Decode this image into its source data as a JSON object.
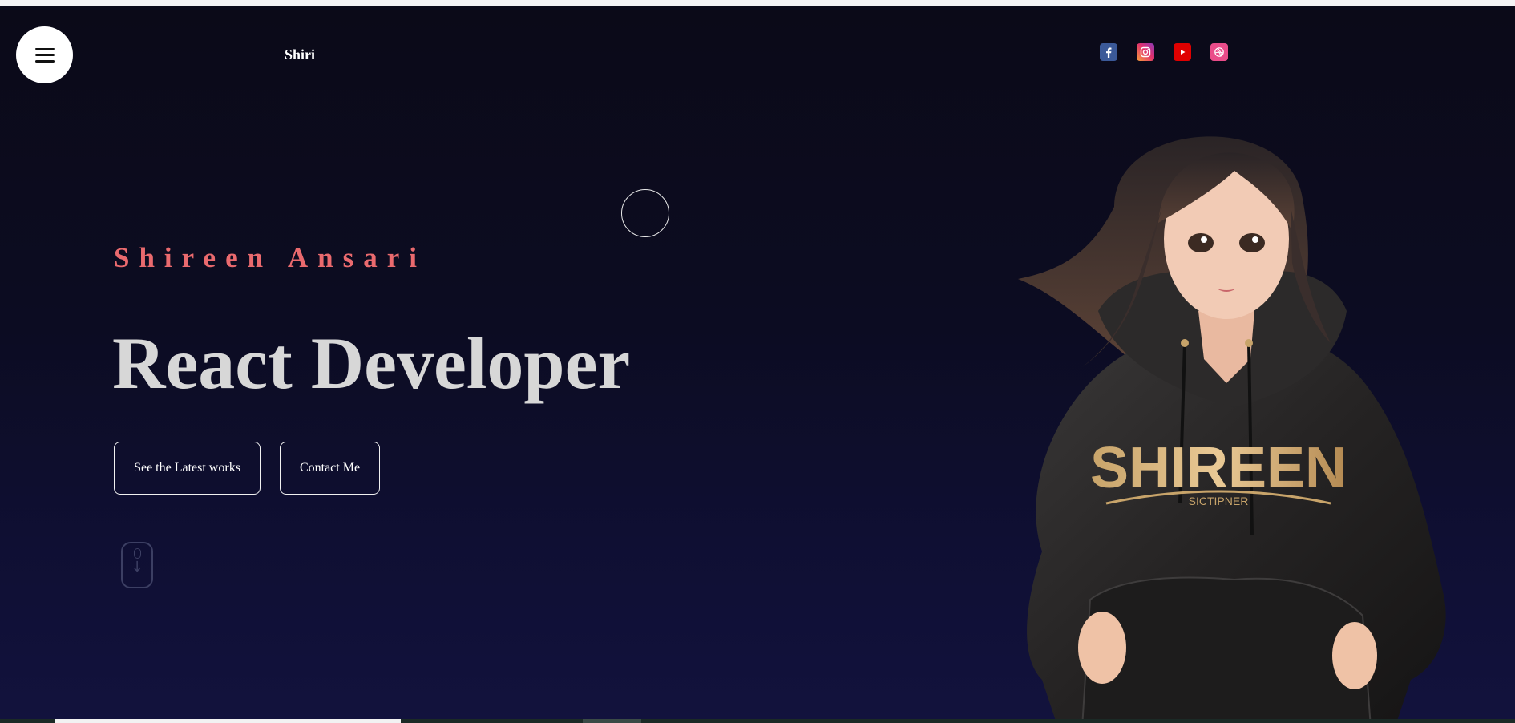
{
  "header": {
    "logo_text": "Shiri",
    "menu_icon": "hamburger-menu-icon",
    "social_links": [
      {
        "name": "facebook-icon",
        "color": "#3b5998"
      },
      {
        "name": "instagram-icon",
        "color": "#e1306c"
      },
      {
        "name": "youtube-icon",
        "color": "#e00000"
      },
      {
        "name": "dribbble-icon",
        "color": "#ea4c89"
      }
    ]
  },
  "hero": {
    "name": "Shireen Ansari",
    "role": "React Developer",
    "buttons": {
      "latest_works": "See the Latest works",
      "contact": "Contact Me"
    },
    "scroll_icon": "mouse-scroll-icon",
    "illustration": {
      "hoodie_text": "SHIREEN",
      "hoodie_subtext": "SICTIPNER"
    }
  },
  "colors": {
    "background": "#0c0b1c",
    "accent_name": "#ea6a6e",
    "role_text": "#d7d7d7"
  }
}
